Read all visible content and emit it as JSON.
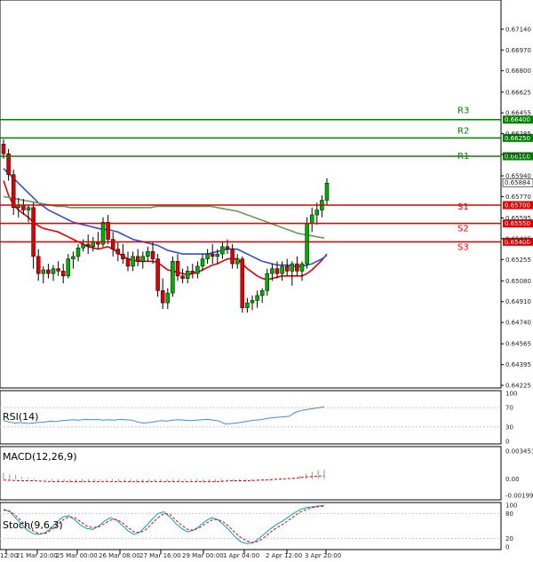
{
  "chart_data": [
    {
      "type": "candlestick",
      "title": "",
      "y_ticks": [
        "0.67140",
        "0.66970",
        "0.66800",
        "0.66625",
        "0.66455",
        "0.66285",
        "0.66115",
        "0.65940",
        "0.65770",
        "0.65595",
        "0.65425",
        "0.65255",
        "0.65080",
        "0.64910",
        "0.64740",
        "0.64565",
        "0.64395",
        "0.64225"
      ],
      "x_ticks": [
        "12:00",
        "21 Mar 20:00",
        "25 Mar 00:00",
        "26 Mar 08:00",
        "27 Mar 16:00",
        "29 Mar 00:00",
        "1 Apr 04:00",
        "2 Apr 12:00",
        "3 Apr 20:00"
      ],
      "ylim": [
        0.64225,
        0.6735
      ],
      "current_price": "0.65884",
      "levels": [
        {
          "name": "R3",
          "value": 0.664,
          "tag": "0.66400",
          "color": "#008000"
        },
        {
          "name": "R2",
          "value": 0.6625,
          "tag": "0.66250",
          "color": "#008000"
        },
        {
          "name": "R1",
          "value": 0.661,
          "tag": "0.66100",
          "color": "#008000"
        },
        {
          "name": "S1",
          "value": 0.657,
          "tag": "0.65700",
          "color": "#e00000"
        },
        {
          "name": "S2",
          "value": 0.6555,
          "tag": "0.65550",
          "color": "#e00000"
        },
        {
          "name": "S3",
          "value": 0.654,
          "tag": "0.65400",
          "color": "#e00000"
        }
      ],
      "candles": [
        [
          0.662,
          0.6624,
          0.6608,
          0.6612
        ],
        [
          0.6612,
          0.6616,
          0.659,
          0.6595
        ],
        [
          0.6595,
          0.6599,
          0.6562,
          0.6568
        ],
        [
          0.6568,
          0.6576,
          0.656,
          0.657
        ],
        [
          0.657,
          0.6575,
          0.6562,
          0.6566
        ],
        [
          0.6566,
          0.657,
          0.6556,
          0.6568
        ],
        [
          0.6568,
          0.6572,
          0.6518,
          0.6528
        ],
        [
          0.6528,
          0.6534,
          0.6508,
          0.6514
        ],
        [
          0.6514,
          0.652,
          0.6506,
          0.6517
        ],
        [
          0.6517,
          0.6522,
          0.651,
          0.6514
        ],
        [
          0.6514,
          0.6521,
          0.6508,
          0.6518
        ],
        [
          0.6518,
          0.6524,
          0.6512,
          0.6516
        ],
        [
          0.6516,
          0.6522,
          0.6506,
          0.6512
        ],
        [
          0.6512,
          0.653,
          0.651,
          0.6526
        ],
        [
          0.6526,
          0.6532,
          0.6518,
          0.6528
        ],
        [
          0.6528,
          0.6538,
          0.6524,
          0.6535
        ],
        [
          0.6535,
          0.6542,
          0.6532,
          0.6538
        ],
        [
          0.6538,
          0.6546,
          0.653,
          0.6536
        ],
        [
          0.6536,
          0.6544,
          0.6532,
          0.654
        ],
        [
          0.654,
          0.6548,
          0.6534,
          0.6538
        ],
        [
          0.6538,
          0.656,
          0.6536,
          0.6556
        ],
        [
          0.6556,
          0.6562,
          0.6538,
          0.6542
        ],
        [
          0.6542,
          0.6548,
          0.6528,
          0.6534
        ],
        [
          0.6534,
          0.654,
          0.6524,
          0.653
        ],
        [
          0.653,
          0.6538,
          0.6522,
          0.6526
        ],
        [
          0.6526,
          0.6532,
          0.6516,
          0.652
        ],
        [
          0.652,
          0.6532,
          0.6516,
          0.6528
        ],
        [
          0.6528,
          0.6534,
          0.652,
          0.6524
        ],
        [
          0.6524,
          0.6532,
          0.6518,
          0.6528
        ],
        [
          0.6528,
          0.6536,
          0.6524,
          0.6532
        ],
        [
          0.6532,
          0.654,
          0.6522,
          0.6526
        ],
        [
          0.6526,
          0.653,
          0.6495,
          0.65
        ],
        [
          0.65,
          0.651,
          0.6485,
          0.649
        ],
        [
          0.649,
          0.6502,
          0.6485,
          0.6498
        ],
        [
          0.6498,
          0.6528,
          0.6495,
          0.6524
        ],
        [
          0.6524,
          0.653,
          0.6508,
          0.6512
        ],
        [
          0.6512,
          0.6518,
          0.6506,
          0.651
        ],
        [
          0.651,
          0.652,
          0.6506,
          0.6516
        ],
        [
          0.6516,
          0.6522,
          0.651,
          0.6514
        ],
        [
          0.6514,
          0.6524,
          0.651,
          0.652
        ],
        [
          0.652,
          0.653,
          0.6516,
          0.6526
        ],
        [
          0.6526,
          0.6534,
          0.6522,
          0.653
        ],
        [
          0.653,
          0.6538,
          0.6522,
          0.6528
        ],
        [
          0.6528,
          0.6534,
          0.6522,
          0.653
        ],
        [
          0.653,
          0.654,
          0.6526,
          0.6536
        ],
        [
          0.6536,
          0.6542,
          0.653,
          0.6534
        ],
        [
          0.6534,
          0.6538,
          0.6518,
          0.6522
        ],
        [
          0.6522,
          0.653,
          0.6518,
          0.6526
        ],
        [
          0.6526,
          0.6528,
          0.6482,
          0.6486
        ],
        [
          0.6486,
          0.6494,
          0.6482,
          0.649
        ],
        [
          0.649,
          0.6496,
          0.6484,
          0.6492
        ],
        [
          0.6492,
          0.65,
          0.6486,
          0.6496
        ],
        [
          0.6496,
          0.6502,
          0.649,
          0.65
        ],
        [
          0.65,
          0.6518,
          0.6496,
          0.6514
        ],
        [
          0.6514,
          0.6522,
          0.6508,
          0.6518
        ],
        [
          0.6518,
          0.6524,
          0.651,
          0.6514
        ],
        [
          0.6514,
          0.6524,
          0.6508,
          0.652
        ],
        [
          0.652,
          0.6526,
          0.6512,
          0.6516
        ],
        [
          0.6516,
          0.6524,
          0.6504,
          0.6522
        ],
        [
          0.6522,
          0.6528,
          0.6512,
          0.6516
        ],
        [
          0.6516,
          0.6524,
          0.6508,
          0.6522
        ],
        [
          0.6522,
          0.656,
          0.6518,
          0.6555
        ],
        [
          0.6555,
          0.6568,
          0.6548,
          0.6562
        ],
        [
          0.6562,
          0.6572,
          0.6554,
          0.6566
        ],
        [
          0.6566,
          0.6578,
          0.656,
          0.6574
        ],
        [
          0.6574,
          0.6592,
          0.657,
          0.6588
        ]
      ],
      "ma_series": [
        {
          "color": "#e00000",
          "values": [
            0.659,
            0.6578,
            0.657,
            0.6566,
            0.6563,
            0.656,
            0.6556,
            0.6553,
            0.6551,
            0.655,
            0.6549,
            0.6548,
            0.6546,
            0.6544,
            0.6542,
            0.654,
            0.6538,
            0.6536,
            0.6535,
            0.6534,
            0.6535,
            0.6536,
            0.6534,
            0.6531,
            0.6528,
            0.6526,
            0.6525,
            0.6524,
            0.6524,
            0.6524,
            0.6524,
            0.6523,
            0.652,
            0.6517,
            0.6516,
            0.6515,
            0.6514,
            0.6513,
            0.6514,
            0.6515,
            0.6517,
            0.6519,
            0.6521,
            0.6522,
            0.6524,
            0.6526,
            0.6526,
            0.6526,
            0.6522,
            0.6518,
            0.6515,
            0.6512,
            0.651,
            0.6509,
            0.651,
            0.6511,
            0.6512,
            0.6512,
            0.6512,
            0.6512,
            0.6512,
            0.6514,
            0.6517,
            0.6521,
            0.6525,
            0.653
          ]
        },
        {
          "color": "#3050d0",
          "values": [
            0.66,
            0.6596,
            0.6592,
            0.6588,
            0.6584,
            0.658,
            0.6576,
            0.6572,
            0.6569,
            0.6566,
            0.6564,
            0.6562,
            0.656,
            0.6558,
            0.6556,
            0.6555,
            0.6554,
            0.6553,
            0.6552,
            0.6551,
            0.655,
            0.655,
            0.6549,
            0.6548,
            0.6546,
            0.6544,
            0.6542,
            0.6541,
            0.654,
            0.6539,
            0.6538,
            0.6537,
            0.6535,
            0.6533,
            0.6532,
            0.6531,
            0.653,
            0.653,
            0.653,
            0.653,
            0.653,
            0.653,
            0.6531,
            0.6532,
            0.6533,
            0.6534,
            0.6534,
            0.6534,
            0.6532,
            0.653,
            0.6528,
            0.6526,
            0.6524,
            0.6523,
            0.6522,
            0.6521,
            0.6521,
            0.6521,
            0.652,
            0.652,
            0.652,
            0.6521,
            0.6522,
            0.6524,
            0.6526,
            0.6529
          ]
        },
        {
          "color": "#5aa05a",
          "values": [
            0.6577,
            0.6576,
            0.6575,
            0.6574,
            0.6573,
            0.6572,
            0.6571,
            0.657,
            0.6569,
            0.6569,
            0.6568,
            0.6568,
            0.6568,
            0.6568,
            0.6568,
            0.6568,
            0.6568,
            0.6568,
            0.6568,
            0.6568,
            0.6568,
            0.6568,
            0.6568,
            0.6569,
            0.6569,
            0.6569,
            0.6569,
            0.6569,
            0.6569,
            0.6569,
            0.6569,
            0.6569,
            0.6568,
            0.6567,
            0.6566,
            0.6565,
            0.6563,
            0.6561,
            0.6559,
            0.6557,
            0.6555,
            0.6553,
            0.6551,
            0.6549,
            0.6547,
            0.6546,
            0.6545,
            0.6544,
            0.6543
          ]
        }
      ]
    },
    {
      "type": "line",
      "name": "RSI(14)",
      "y_ticks": [
        "100",
        "70",
        "30",
        "0"
      ],
      "ylim": [
        0,
        100
      ],
      "values": [
        43,
        40,
        38,
        39,
        37,
        38,
        39,
        40,
        42,
        41,
        43,
        44,
        45,
        44,
        46,
        45,
        46,
        44,
        45,
        44,
        46,
        45,
        44,
        40,
        38,
        39,
        41,
        43,
        42,
        44,
        45,
        44,
        43,
        44,
        45,
        46,
        44,
        42,
        36,
        37,
        38,
        40,
        42,
        44,
        45,
        47,
        49,
        50,
        51,
        52,
        60,
        64,
        66,
        68,
        70,
        72
      ]
    },
    {
      "type": "bar",
      "name": "MACD(12,26,9)",
      "y_ticks": [
        "0.003453",
        "0.00",
        "-0.001999"
      ],
      "ylim": [
        -0.002,
        0.00345
      ],
      "values": [
        0.0008,
        0.0006,
        0.0005,
        0.0003,
        0.0002,
        0.0001,
        0.0,
        -0.0001,
        -0.0002,
        -0.0003,
        -0.0003,
        -0.0004,
        -0.0004,
        -0.0004,
        -0.0003,
        -0.0003,
        -0.0002,
        -0.0002,
        -0.0002,
        -0.0003,
        -0.0003,
        -0.0004,
        -0.0004,
        -0.0004,
        -0.0003,
        -0.0003,
        -0.0003,
        -0.0003,
        -0.0003,
        -0.0002,
        -0.0002,
        -0.0002,
        -0.0003,
        -0.0004,
        -0.0004,
        -0.0004,
        -0.0004,
        -0.0003,
        -0.0003,
        -0.0003,
        -0.0003,
        -0.0003,
        -0.0002,
        -0.0002,
        -0.0002,
        -0.0001,
        -0.0001,
        0.0,
        0.0002,
        0.0004,
        0.0007,
        0.0009,
        0.0011,
        0.0012
      ],
      "signal": [
        -0.0001,
        -0.0002,
        -0.0002,
        -0.0003,
        -0.0003,
        -0.0003,
        -0.0003,
        -0.0003,
        -0.0003,
        -0.0003,
        -0.0003,
        -0.0003,
        -0.0003,
        -0.0003,
        -0.0003,
        -0.0002,
        -0.0002,
        -0.0001,
        0.0,
        0.0001,
        0.0003,
        0.0004
      ]
    },
    {
      "type": "line",
      "name": "Stoch(9,6,3)",
      "y_ticks": [
        "100",
        "80",
        "20",
        "0"
      ],
      "ylim": [
        0,
        100
      ],
      "series": [
        {
          "color": "#00a0c0",
          "values": [
            90,
            85,
            70,
            55,
            40,
            32,
            30,
            34,
            45,
            60,
            72,
            75,
            65,
            52,
            44,
            42,
            50,
            62,
            70,
            64,
            52,
            38,
            30,
            36,
            50,
            66,
            80,
            84,
            72,
            56,
            44,
            36,
            40,
            50,
            62,
            70,
            66,
            54,
            40,
            24,
            12,
            8,
            10,
            20,
            32,
            44,
            54,
            62,
            72,
            82,
            90,
            94,
            96,
            98,
            99
          ]
        },
        {
          "color": "#e00000",
          "values": [
            88,
            86,
            76,
            62,
            48,
            38,
            32,
            32,
            40,
            52,
            65,
            72,
            70,
            60,
            50,
            46,
            48,
            56,
            64,
            66,
            58,
            46,
            36,
            34,
            42,
            56,
            70,
            80,
            78,
            64,
            52,
            42,
            40,
            46,
            56,
            64,
            66,
            60,
            48,
            34,
            22,
            14,
            10,
            14,
            24,
            36,
            46,
            54,
            64,
            74,
            84,
            90,
            94,
            96,
            98
          ]
        }
      ]
    }
  ],
  "indicators": {
    "rsi": {
      "label": "RSI(14)"
    },
    "macd": {
      "label": "MACD(12,26,9)"
    },
    "stoch": {
      "label": "Stoch(9,6,3)"
    }
  }
}
